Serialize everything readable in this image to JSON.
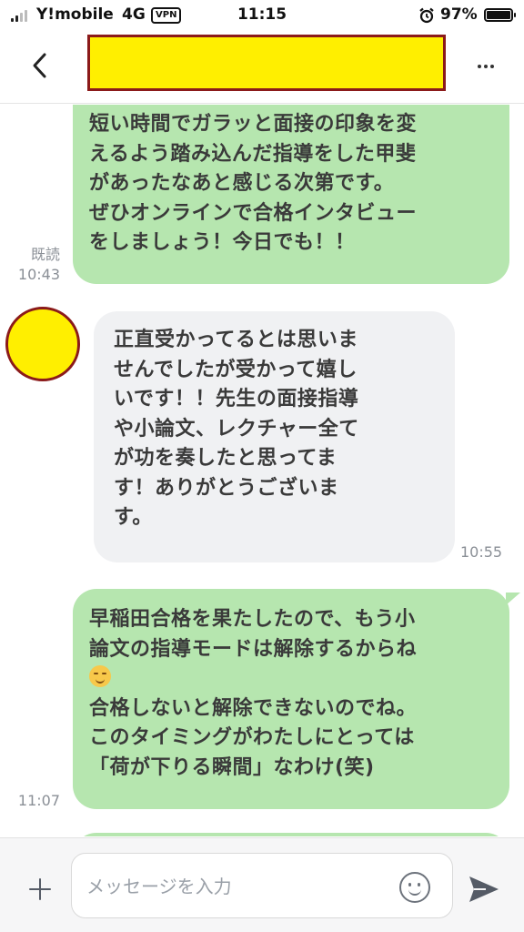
{
  "status_bar": {
    "carrier": "Y!mobile",
    "network": "4G",
    "vpn": "VPN",
    "time": "11:15",
    "battery": "97%",
    "battery_level": 0.97,
    "icons": [
      "signal-icon",
      "alarm-icon",
      "battery-icon"
    ]
  },
  "header": {
    "icons": [
      "back-icon",
      "more-icon"
    ],
    "title_redacted": true
  },
  "messages": [
    {
      "side": "sent",
      "lines": [
        "短い時間でガラッと面接の印象を変",
        "えるよう踏み込んだ指導をした甲斐",
        "があったなあと感じる次第です。",
        "ぜひオンラインで合格インタビュー",
        "をしましょう！今日でも！！"
      ],
      "read": "既読",
      "time": "10:43"
    },
    {
      "side": "received",
      "lines": [
        "正直受かってるとは思いま",
        "せんでしたが受かって嬉し",
        "いです！！先生の面接指導",
        "や小論文、レクチャー全て",
        "が功を奏したと思ってま",
        "す！ありがとうございま",
        "す。"
      ],
      "time": "10:55"
    },
    {
      "side": "sent",
      "lines": [
        "早稲田合格を果たしたので、もう小",
        "論文の指導モードは解除するからね",
        "",
        "合格しないと解除できないのでね。",
        "このタイミングがわたしにとっては",
        "「荷が下りる瞬間」なわけ(笑)"
      ],
      "time": "11:07"
    }
  ],
  "input_bar": {
    "placeholder": "メッセージを入力",
    "value": "",
    "icons": [
      "plus-icon",
      "emoji-icon",
      "send-icon"
    ]
  },
  "colors": {
    "sent_bubble": "#b6e6af",
    "received_bubble": "#f0f1f3",
    "redaction_fill": "#ffef00",
    "redaction_border": "#8b1a1a"
  }
}
